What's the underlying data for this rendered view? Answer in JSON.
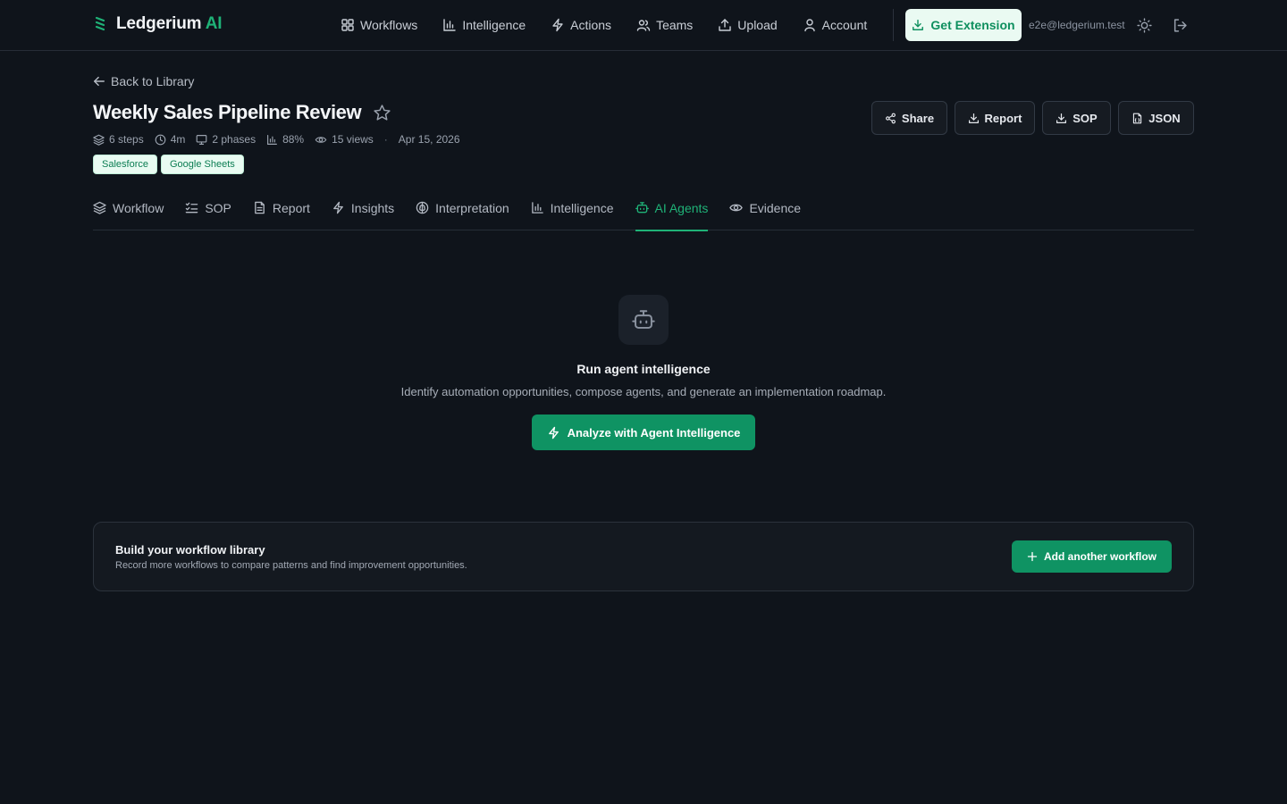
{
  "header": {
    "brand": {
      "name": "Ledgerium",
      "accent": "AI",
      "icon": "ledger-logo-icon",
      "accent_color": "#1fb277"
    },
    "nav": [
      {
        "label": "Workflows",
        "icon": "grid-icon"
      },
      {
        "label": "Intelligence",
        "icon": "bar-chart-icon"
      },
      {
        "label": "Actions",
        "icon": "bolt-icon"
      },
      {
        "label": "Teams",
        "icon": "users-icon"
      },
      {
        "label": "Upload",
        "icon": "upload-icon"
      },
      {
        "label": "Account",
        "icon": "user-icon"
      }
    ],
    "extension_label": "Get Extension",
    "email": "e2e@ledgerium.test"
  },
  "page": {
    "back_label": "Back to Library",
    "title": "Weekly Sales Pipeline Review",
    "meta": {
      "steps": "6 steps",
      "duration": "4m",
      "phases": "2 phases",
      "score": "88%",
      "views": "15 views",
      "separator": "·",
      "date": "Apr 15, 2026"
    },
    "tags": [
      "Salesforce",
      "Google Sheets"
    ],
    "actions": {
      "share": "Share",
      "report": "Report",
      "sop": "SOP",
      "json": "JSON"
    }
  },
  "tabs": [
    {
      "label": "Workflow",
      "icon": "layers-icon"
    },
    {
      "label": "SOP",
      "icon": "checklist-icon"
    },
    {
      "label": "Report",
      "icon": "document-icon"
    },
    {
      "label": "Insights",
      "icon": "bolt-icon"
    },
    {
      "label": "Interpretation",
      "icon": "brain-icon"
    },
    {
      "label": "Intelligence",
      "icon": "bar-chart-icon"
    },
    {
      "label": "AI Agents",
      "icon": "robot-icon",
      "active": true
    },
    {
      "label": "Evidence",
      "icon": "eye-icon"
    }
  ],
  "empty_state": {
    "icon": "robot-icon",
    "title": "Run agent intelligence",
    "description": "Identify automation opportunities, compose agents, and generate an implementation roadmap.",
    "button_label": "Analyze with Agent Intelligence"
  },
  "library_card": {
    "title": "Build your workflow library",
    "description": "Record more workflows to compare patterns and find improvement opportunities.",
    "button_label": "Add another workflow"
  }
}
